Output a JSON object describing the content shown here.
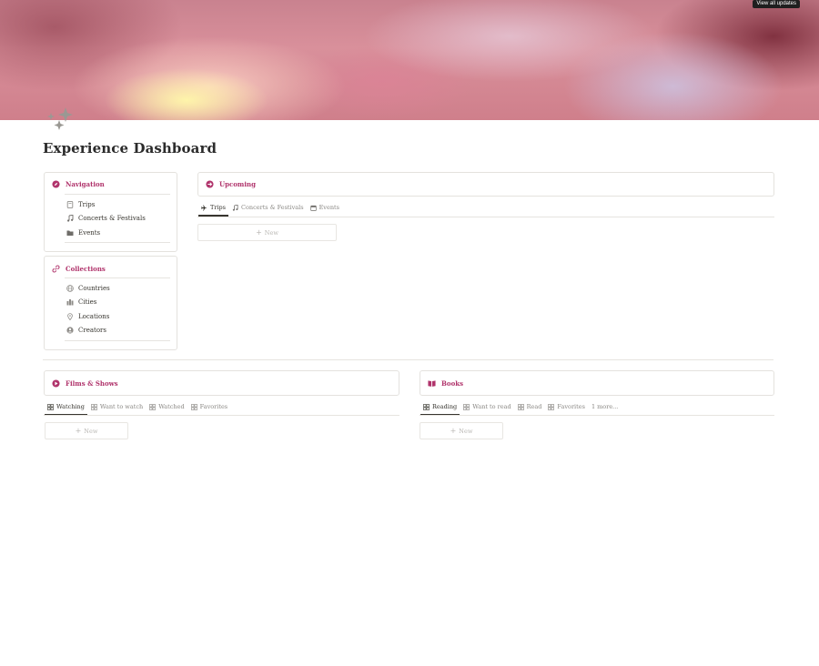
{
  "cover": {
    "updates_label": "View all updates"
  },
  "page": {
    "title": "Experience Dashboard",
    "accent": "#b0336b"
  },
  "navigation": {
    "title": "Navigation",
    "items": [
      {
        "label": "Trips",
        "icon": "book-icon"
      },
      {
        "label": "Concerts & Festivals",
        "icon": "music-note-icon"
      },
      {
        "label": "Events",
        "icon": "folder-icon"
      }
    ]
  },
  "collections": {
    "title": "Collections",
    "items": [
      {
        "label": "Countries",
        "icon": "globe-icon"
      },
      {
        "label": "Cities",
        "icon": "city-icon"
      },
      {
        "label": "Locations",
        "icon": "pin-icon"
      },
      {
        "label": "Creators",
        "icon": "user-icon"
      }
    ]
  },
  "upcoming": {
    "title": "Upcoming",
    "tabs": [
      {
        "label": "Trips",
        "icon": "airplane-icon"
      },
      {
        "label": "Concerts & Festivals",
        "icon": "music-note-icon"
      },
      {
        "label": "Events",
        "icon": "calendar-icon"
      }
    ],
    "new_label": "New"
  },
  "films": {
    "title": "Films & Shows",
    "tabs": [
      {
        "label": "Watching"
      },
      {
        "label": "Want to watch"
      },
      {
        "label": "Watched"
      },
      {
        "label": "Favorites"
      }
    ],
    "new_label": "New"
  },
  "books": {
    "title": "Books",
    "tabs": [
      {
        "label": "Reading"
      },
      {
        "label": "Want to read"
      },
      {
        "label": "Read"
      },
      {
        "label": "Favorites"
      }
    ],
    "more_label": "1 more...",
    "new_label": "New"
  }
}
